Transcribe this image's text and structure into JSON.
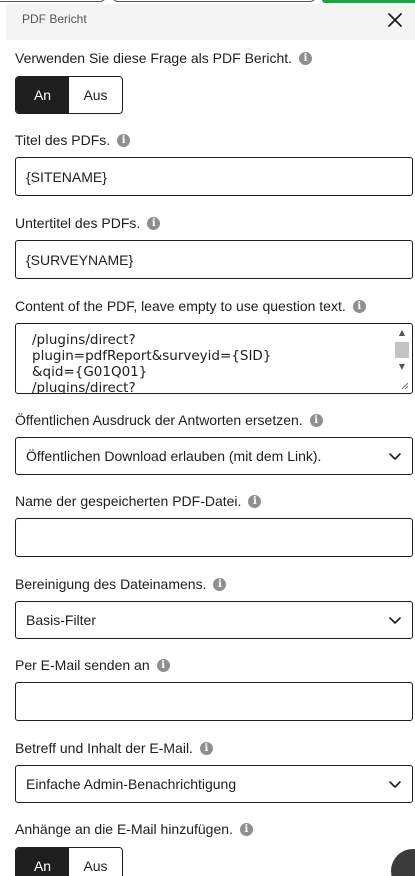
{
  "header": {
    "title": "PDF Bericht"
  },
  "use_as_pdf": {
    "label": "Verwenden Sie diese Frage als PDF Bericht.",
    "on": "An",
    "off": "Aus"
  },
  "pdf_title": {
    "label": "Titel des PDFs.",
    "value": "{SITENAME}"
  },
  "pdf_subtitle": {
    "label": "Untertitel des PDFs.",
    "value": "{SURVEYNAME}"
  },
  "pdf_content": {
    "label": "Content of the PDF, leave empty to use question text.",
    "lines": [
      "/plugins/direct?",
      "plugin=pdfReport&surveyid={SID}",
      "&qid={G01Q01}",
      "/plugins/direct?"
    ]
  },
  "public_print": {
    "label": "Öffentlichen Ausdruck der Antworten ersetzen.",
    "selected": "Öffentlichen Download erlauben (mit dem Link)."
  },
  "filename": {
    "label": "Name der gespeicherten PDF-Datei.",
    "value": ""
  },
  "filename_cleanup": {
    "label": "Bereinigung des Dateinamens.",
    "selected": "Basis-Filter"
  },
  "email_send": {
    "label": "Per E-Mail senden an",
    "value": ""
  },
  "email_subject": {
    "label": "Betreff und Inhalt der E-Mail.",
    "selected": "Einfache Admin-Benachrichtigung"
  },
  "email_attach": {
    "label": "Anhänge an die E-Mail hinzufügen.",
    "on": "An",
    "off": "Aus"
  },
  "icons": {
    "close": "close-icon",
    "info": "info-icon",
    "chevron": "chevron-down-icon"
  }
}
